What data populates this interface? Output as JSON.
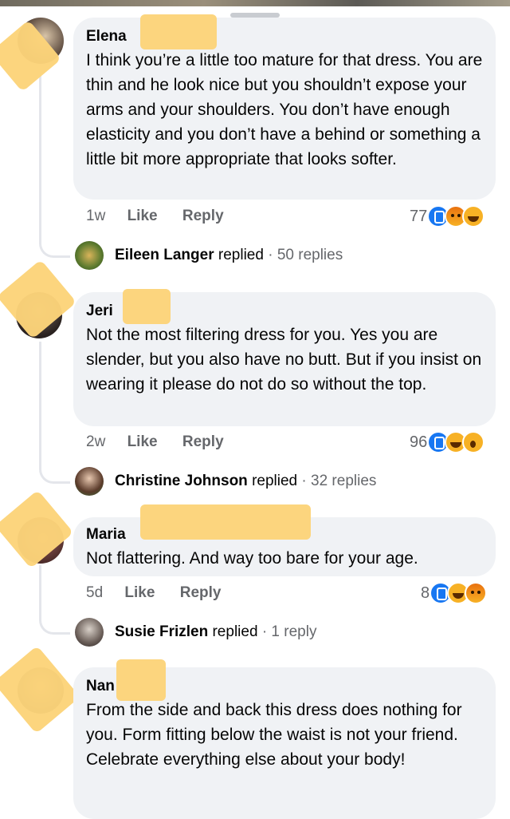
{
  "comments": [
    {
      "name": "Elena",
      "text": "I think you’re a little too mature for that dress. You are thin and he look nice but you shouldn’t expose your arms and your shoulders. You don’t have enough elasticity and you don’t have a behind or something a little bit more appropriate that looks softer.",
      "time": "1w",
      "like": "Like",
      "reply": "Reply",
      "reactions": "77",
      "reaction_icons": [
        "like-icon",
        "angry-icon",
        "haha-icon"
      ],
      "replied_name": "Eileen Langer",
      "replied_text": "replied",
      "replied_count": "· 50 replies"
    },
    {
      "name": "Jeri",
      "text": "Not the most filtering dress for you.  Yes you are slender, but you also have no butt.  But if you insist on wearing it please do not do so without the top.",
      "time": "2w",
      "like": "Like",
      "reply": "Reply",
      "reactions": "96",
      "reaction_icons": [
        "like-icon",
        "haha-icon",
        "wow-icon"
      ],
      "replied_name": "Christine Johnson",
      "replied_text": "replied",
      "replied_count": "· 32 replies"
    },
    {
      "name": "Maria",
      "text": "Not flattering. And way too bare for your age.",
      "time": "5d",
      "like": "Like",
      "reply": "Reply",
      "reactions": "8",
      "reaction_icons": [
        "like-icon",
        "haha-icon",
        "angry-icon"
      ],
      "replied_name": "Susie Frizlen",
      "replied_text": "replied",
      "replied_count": "· 1 reply"
    },
    {
      "name": "Nan",
      "text": "From the side and back this dress does nothing for you. Form fitting below the waist is not your friend. Celebrate everything else about your body!"
    }
  ],
  "colors": {
    "bubble": "#f0f2f5",
    "muted": "#65676b",
    "like_blue": "#1877f2",
    "redaction": "#fcd47a"
  }
}
